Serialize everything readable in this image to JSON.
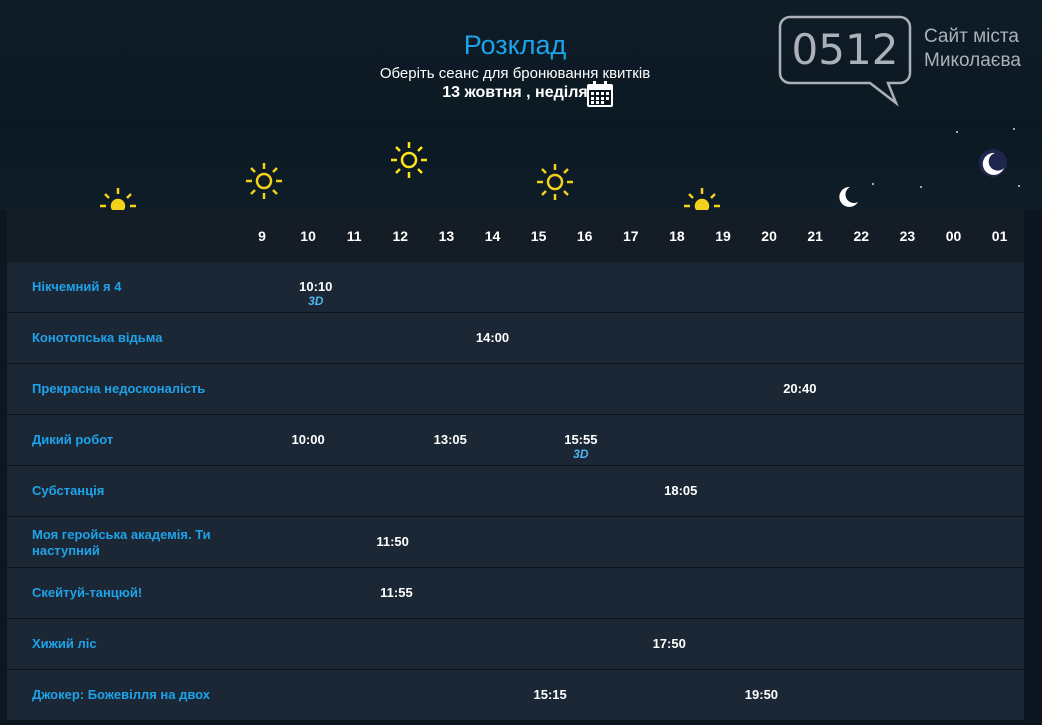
{
  "header": {
    "title": "Розклад",
    "subtitle": "Оберіть сеанс для бронювання квитків",
    "date": "13 жовтня , неділя"
  },
  "logo": {
    "number": "0512",
    "line1": "Сайт міста",
    "line2": "Миколаєва"
  },
  "icons": {
    "calendar": "calendar-icon",
    "sun": "sun-icon",
    "moon": "moon-icon"
  },
  "colors": {
    "accent": "#1ea3ea",
    "background": "#0b1620",
    "row": "#1b2734",
    "header_row": "#141c25"
  },
  "hours": [
    "9",
    "10",
    "11",
    "12",
    "13",
    "14",
    "15",
    "16",
    "17",
    "18",
    "19",
    "20",
    "21",
    "22",
    "23",
    "00",
    "01"
  ],
  "movies": [
    {
      "title": "Нікчемний я 4",
      "sessions": [
        {
          "time": "10:10",
          "badge": "3D"
        }
      ]
    },
    {
      "title": "Конотопська відьма",
      "sessions": [
        {
          "time": "14:00"
        }
      ]
    },
    {
      "title": "Прекрасна недосконаліcть",
      "sessions": [
        {
          "time": "20:40"
        }
      ]
    },
    {
      "title": "Дикий робот",
      "sessions": [
        {
          "time": "10:00"
        },
        {
          "time": "13:05"
        },
        {
          "time": "15:55",
          "badge": "3D"
        }
      ]
    },
    {
      "title": "Субстанція",
      "sessions": [
        {
          "time": "18:05"
        }
      ]
    },
    {
      "title": "Моя геройська академія. Ти наступний",
      "sessions": [
        {
          "time": "11:50"
        }
      ]
    },
    {
      "title": "Скейтуй-танцюй!",
      "sessions": [
        {
          "time": "11:55"
        }
      ]
    },
    {
      "title": "Хижий ліс",
      "sessions": [
        {
          "time": "17:50"
        }
      ]
    },
    {
      "title": "Джокер: Божевілля на двох",
      "sessions": [
        {
          "time": "15:15"
        },
        {
          "time": "19:50"
        }
      ]
    }
  ]
}
